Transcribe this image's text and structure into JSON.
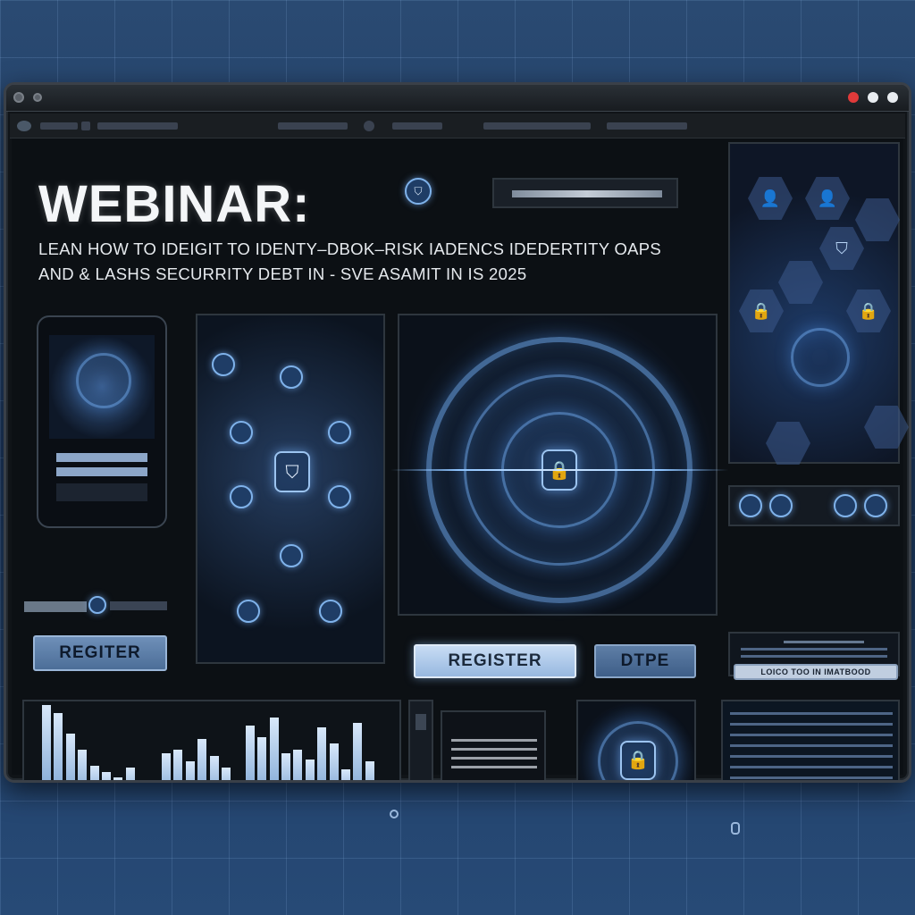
{
  "hero": {
    "title": "WEBINAR:",
    "subtitle_line1": "LEAN HOW TO IDEIGIT TO IDENTY–DBOK–RISK IADENCS IDEDERTITY OAPS",
    "subtitle_line2": "AND & LASHS SECURRITY DEBT IN - SVE ASAMIT IN IS 2025"
  },
  "buttons": {
    "register_left": "REGITER",
    "register_center": "REGISTER",
    "date": "DTPE",
    "small_action": "LOICO TOO IN IMATBOOD"
  },
  "icons": {
    "lock": "🔒",
    "shield": "⛉",
    "user": "👤"
  },
  "colors": {
    "accent": "#6fa6e6",
    "window_bg": "#0c1014",
    "titlebar_red": "#e03a3a"
  },
  "chart_data": {
    "type": "bar",
    "values": [
      92,
      84,
      64,
      48,
      32,
      26,
      20,
      30,
      16,
      12,
      44,
      48,
      36,
      58,
      42,
      30,
      4,
      72,
      60,
      80,
      44,
      48,
      38,
      70,
      54,
      28,
      74,
      36,
      18,
      12
    ]
  }
}
